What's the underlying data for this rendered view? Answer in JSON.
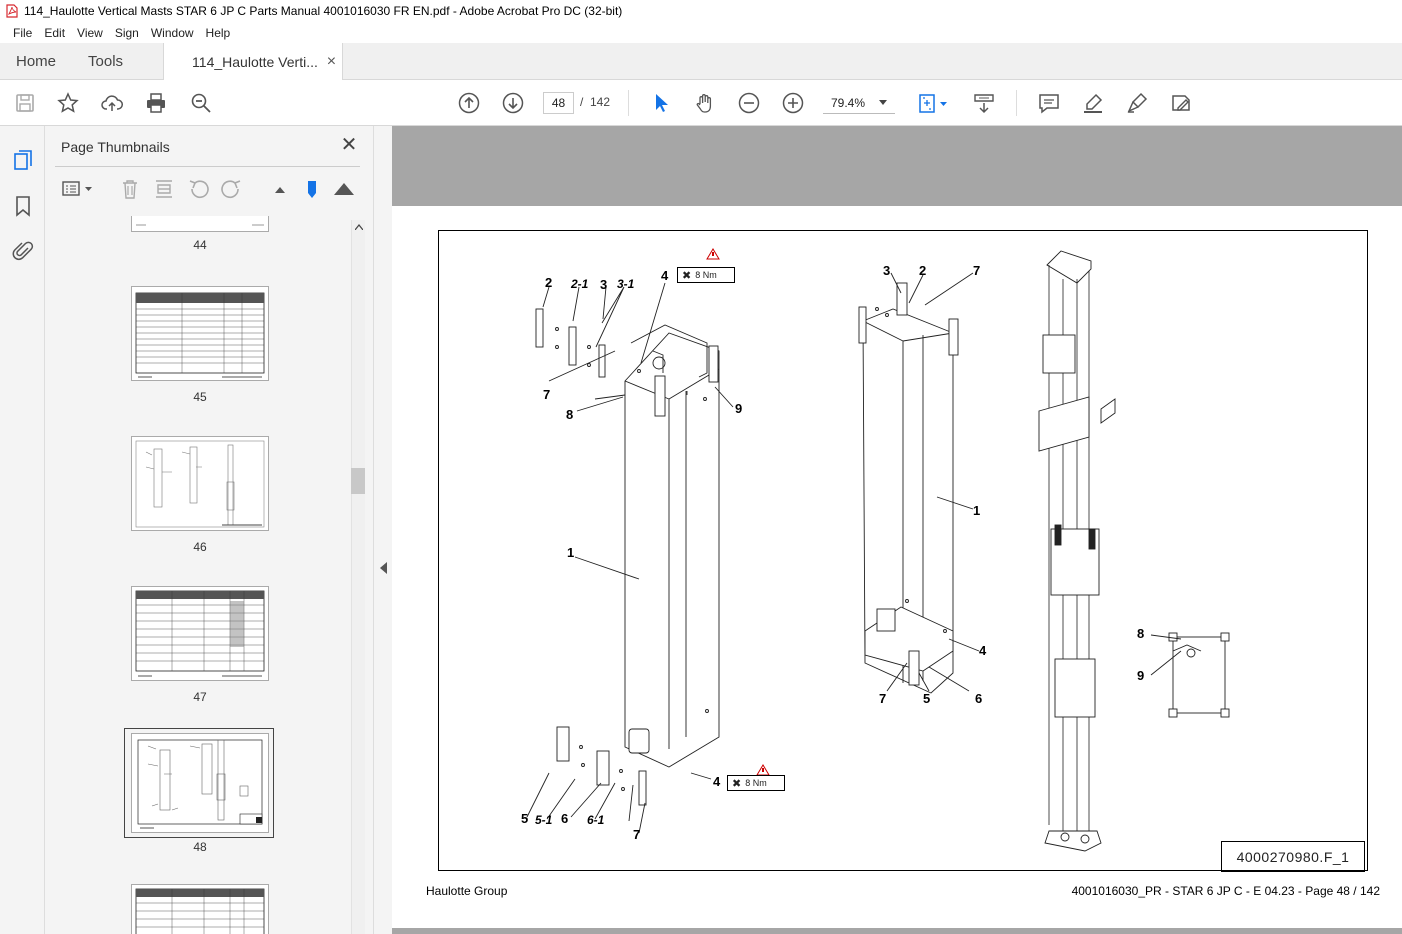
{
  "window": {
    "title": "114_Haulotte Vertical Masts STAR 6 JP C Parts Manual 4001016030 FR EN.pdf - Adobe Acrobat Pro DC (32-bit)"
  },
  "menu": [
    "File",
    "Edit",
    "View",
    "Sign",
    "Window",
    "Help"
  ],
  "tabs": {
    "home": "Home",
    "tools": "Tools",
    "document": "114_Haulotte Verti...",
    "close": "×"
  },
  "toolbar": {
    "current_page": "48",
    "page_separator": "/",
    "total_pages": "142",
    "zoom": "79.4%"
  },
  "panel": {
    "title": "Page Thumbnails",
    "close": "✕",
    "thumbnails": [
      "44",
      "45",
      "46",
      "47",
      "48"
    ],
    "selected": "48"
  },
  "document": {
    "footer_left": "Haulotte Group",
    "footer_right": "4001016030_PR - STAR 6 JP C - E 04.23 - Page 48 / 142",
    "drawing_ref": "4000270980.F_1",
    "torque_label": "8 Nm",
    "callouts": {
      "a_2": "2",
      "a_2_1": "2-1",
      "a_3": "3",
      "a_3_1": "3-1",
      "a_4": "4",
      "a_7": "7",
      "a_8": "8",
      "a_9": "9",
      "a_1": "1",
      "a_5": "5",
      "a_5_1": "5-1",
      "a_6": "6",
      "a_6_1": "6-1",
      "a_7b": "7",
      "a_4b": "4",
      "b_3": "3",
      "b_2": "2",
      "b_7": "7",
      "b_1": "1",
      "b_4": "4",
      "b_7b": "7",
      "b_5": "5",
      "b_6": "6",
      "d_8": "8",
      "d_9": "9"
    }
  },
  "colors": {
    "viewer_bg": "#a6a6a6",
    "accent": "#1473e6",
    "panel_bg": "#f4f4f4"
  }
}
